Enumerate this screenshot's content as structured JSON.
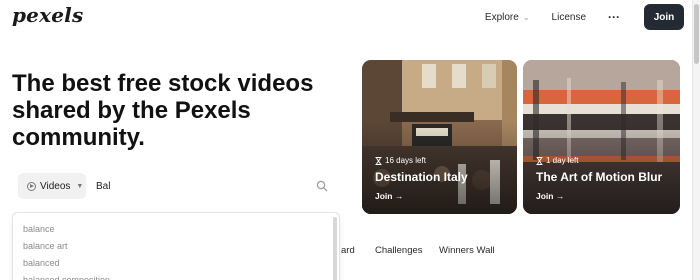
{
  "header": {
    "logo": "pexels",
    "nav": {
      "explore": "Explore",
      "license": "License",
      "more": "···",
      "join": "Join"
    }
  },
  "hero": {
    "title": "The best free stock videos shared by the Pexels community."
  },
  "search": {
    "type_label": "Videos",
    "value": "Bal",
    "placeholder": ""
  },
  "suggestions": [
    "balance",
    "balance art",
    "balanced",
    "balanced composition"
  ],
  "tabs": {
    "partial": "ard",
    "challenges": "Challenges",
    "winners": "Winners Wall"
  },
  "cards": [
    {
      "time_left": "16 days left",
      "title": "Destination Italy",
      "cta": "Join →"
    },
    {
      "time_left": "1 day left",
      "title": "The Art of Motion Blur",
      "cta": "Join →"
    }
  ],
  "colors": {
    "join_button": "#232a34",
    "text": "#1a1a1a",
    "muted": "#8c8c8c"
  },
  "icons": [
    "chevron-down-icon",
    "more-icon",
    "play-icon",
    "search-icon",
    "hourglass-icon"
  ]
}
